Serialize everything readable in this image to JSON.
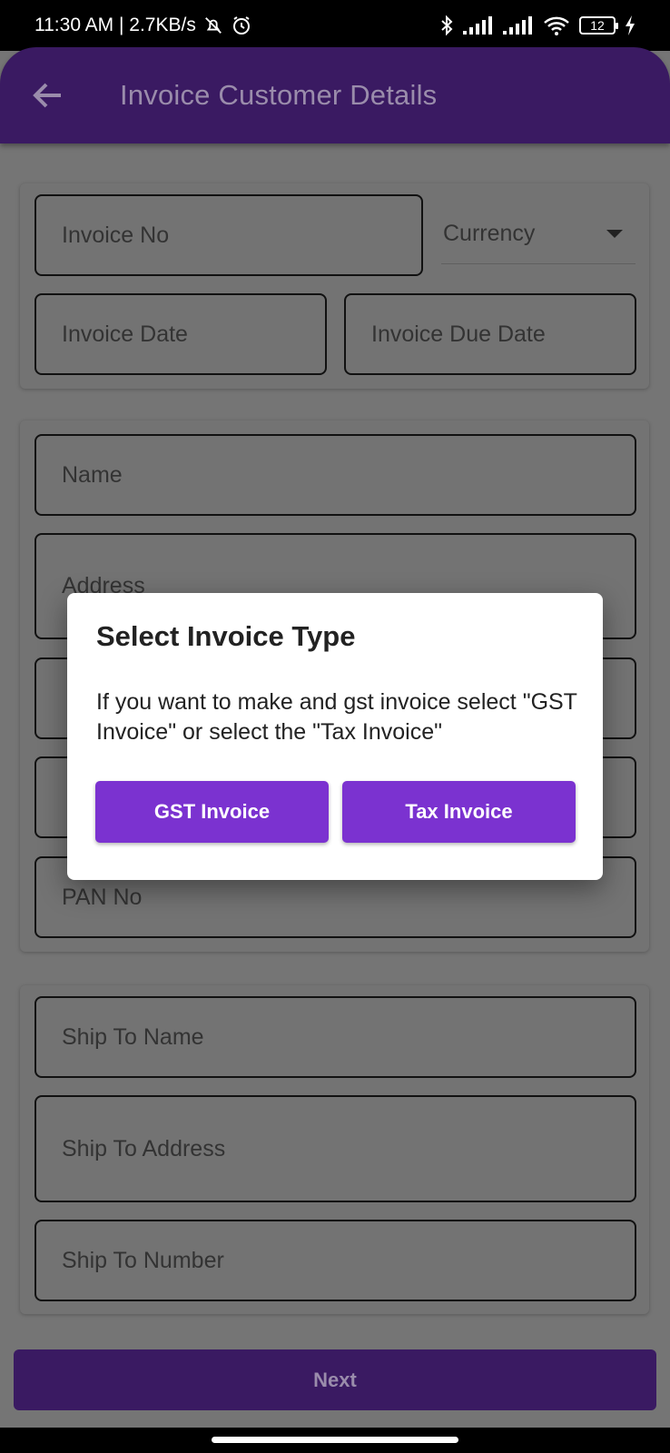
{
  "status_bar": {
    "left_text": "11:30 AM | 2.7KB/s",
    "icons": [
      "bell-off-icon",
      "alarm-icon",
      "bluetooth-icon",
      "signal-icon",
      "signal-icon",
      "wifi-icon",
      "battery-icon",
      "charging-icon"
    ],
    "battery_level": "12"
  },
  "app_bar": {
    "title": "Invoice Customer Details",
    "back_icon": "arrow-left-icon"
  },
  "invoice_section": {
    "invoice_no_placeholder": "Invoice No",
    "currency_placeholder": "Currency",
    "invoice_date_placeholder": "Invoice Date",
    "invoice_due_date_placeholder": "Invoice Due Date"
  },
  "customer_section": {
    "name_placeholder": "Name",
    "address_placeholder": "Address",
    "pan_placeholder": "PAN No"
  },
  "shipping_section": {
    "ship_name_placeholder": "Ship To Name",
    "ship_address_placeholder": "Ship To Address",
    "ship_number_placeholder": "Ship To Number"
  },
  "next_label": "Next",
  "dialog": {
    "title": "Select Invoice Type",
    "message": "If you want to make and gst invoice select \"GST Invoice\" or select the \"Tax Invoice\"",
    "gst_button": "GST Invoice",
    "tax_button": "Tax Invoice"
  },
  "colors": {
    "app_bar": "#3a1a62",
    "dialog_button": "#7b32d0",
    "scrim_background": "#757575"
  }
}
